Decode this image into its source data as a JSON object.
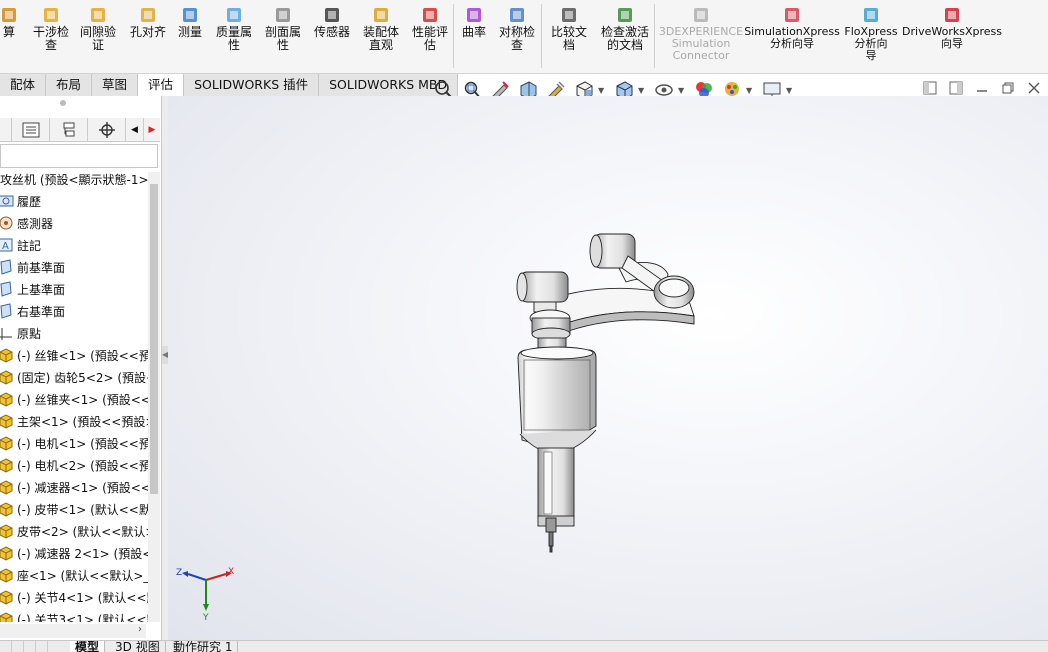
{
  "ribbon": {
    "items": [
      {
        "label": "算",
        "icon": "calculate-icon"
      },
      {
        "label": "干涉检\n查",
        "icon": "interference-check-icon"
      },
      {
        "label": "间隙验\n证",
        "icon": "clearance-verify-icon"
      },
      {
        "label": "孔对齐",
        "icon": "hole-align-icon"
      },
      {
        "label": "测量",
        "icon": "measure-icon"
      },
      {
        "label": "质量属\n性",
        "icon": "mass-properties-icon"
      },
      {
        "label": "剖面属\n性",
        "icon": "section-properties-icon"
      },
      {
        "label": "传感器",
        "icon": "sensor-icon"
      },
      {
        "label": "装配体\n直观",
        "icon": "assembly-visualization-icon"
      },
      {
        "label": "性能评\n估",
        "icon": "performance-evaluation-icon"
      },
      {
        "label": "曲率",
        "icon": "curvature-icon"
      },
      {
        "label": "对称检\n查",
        "icon": "symmetry-check-icon"
      },
      {
        "label": "比较文\n档",
        "icon": "compare-documents-icon"
      },
      {
        "label": "检查激活\n的文档",
        "icon": "check-active-document-icon"
      },
      {
        "label": "3DEXPERIENCE\nSimulation\nConnector",
        "icon": "simulation-connector-icon",
        "disabled": true
      },
      {
        "label": "SimulationXpress\n分析向导",
        "icon": "simulationxpress-icon"
      },
      {
        "label": "FloXpress\n分析向\n导",
        "icon": "floxpress-icon"
      },
      {
        "label": "DriveWorksXpress\n向导",
        "icon": "driveworksxpress-icon"
      }
    ]
  },
  "tabs": [
    {
      "label": "配体"
    },
    {
      "label": "布局"
    },
    {
      "label": "草图"
    },
    {
      "label": "评估",
      "active": true
    },
    {
      "label": "SOLIDWORKS 插件"
    },
    {
      "label": "SOLIDWORKS MBD"
    }
  ],
  "tree": {
    "items": [
      {
        "label": "攻丝机 (预設<顯示狀態-1>",
        "icon": "assembly-icon"
      },
      {
        "label": "履歷",
        "icon": "history-icon"
      },
      {
        "label": "感測器",
        "icon": "sensor-folder-icon"
      },
      {
        "label": "註記",
        "icon": "annotations-icon"
      },
      {
        "label": "前基準面",
        "icon": "plane-icon"
      },
      {
        "label": "上基準面",
        "icon": "plane-icon"
      },
      {
        "label": "右基準面",
        "icon": "plane-icon"
      },
      {
        "label": "原點",
        "icon": "origin-icon"
      },
      {
        "label": "(-) 丝锥<1> (預設<<預",
        "icon": "part-icon"
      },
      {
        "label": "(固定) 齿轮5<2> (預設<",
        "icon": "part-icon"
      },
      {
        "label": "(-) 丝锥夹<1> (預設<<",
        "icon": "part-icon"
      },
      {
        "label": "主架<1> (預設<<預設>",
        "icon": "part-icon"
      },
      {
        "label": "(-) 电机<1> (預設<<預",
        "icon": "part-icon"
      },
      {
        "label": "(-) 电机<2> (預設<<預",
        "icon": "part-icon"
      },
      {
        "label": "(-) 减速器<1> (預設<<",
        "icon": "part-icon"
      },
      {
        "label": "(-) 皮带<1> (默认<<默",
        "icon": "part-icon"
      },
      {
        "label": "皮带<2> (默认<<默认>",
        "icon": "part-icon"
      },
      {
        "label": "(-) 减速器 2<1> (預設<",
        "icon": "part-icon"
      },
      {
        "label": "座<1> (默认<<默认>_显",
        "icon": "part-icon"
      },
      {
        "label": "(-) 关节4<1> (默认<<默",
        "icon": "part-icon"
      },
      {
        "label": "(-) 关节3<1> (默认<<默",
        "icon": "part-icon"
      }
    ]
  },
  "triad": {
    "x": "X",
    "y": "Y",
    "z": "Z"
  },
  "bottom_tabs": [
    {
      "label": "模型",
      "active": true
    },
    {
      "label": "3D 视图"
    },
    {
      "label": "動作研究 1"
    }
  ],
  "colors": {
    "ribbon_bg": "#f5f5f5",
    "active_tab": "#ffffff",
    "folder_yellow": "#f1c232",
    "axis_x": "#cc2222",
    "axis_y": "#1c8a1c",
    "axis_z": "#2244bb"
  }
}
